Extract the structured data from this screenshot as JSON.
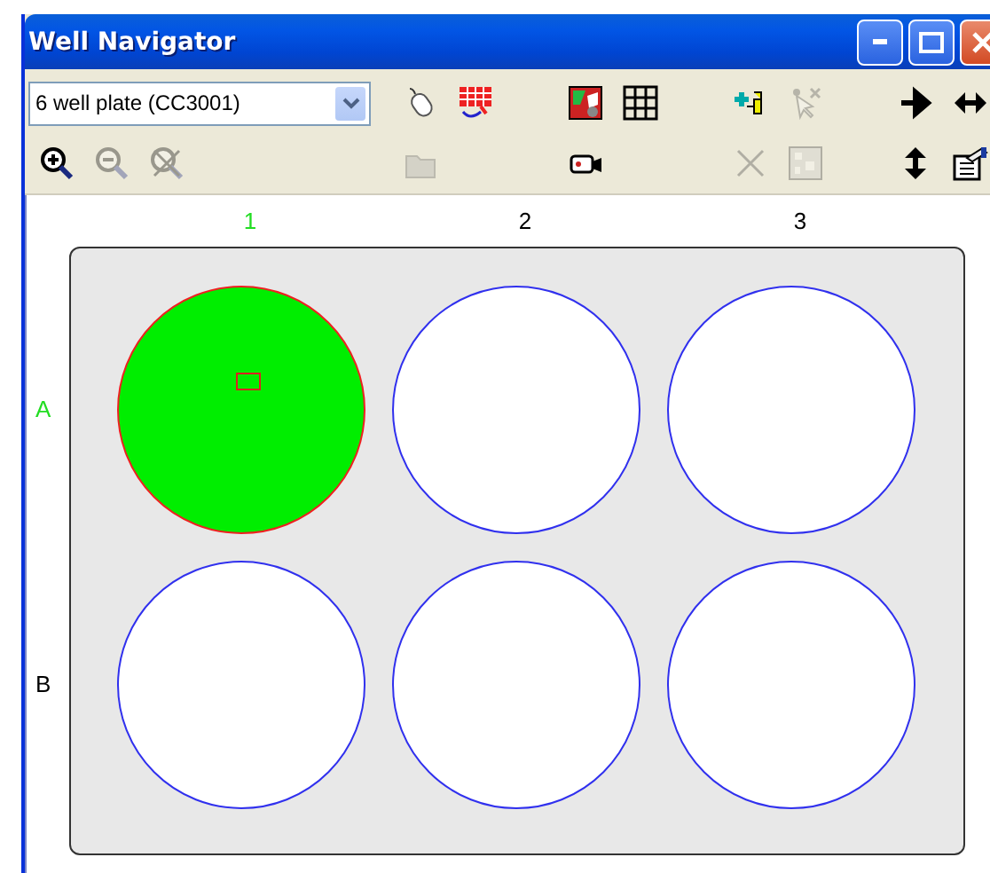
{
  "window": {
    "title": "Well Navigator"
  },
  "plate_select": {
    "value": "6 well plate (CC3001)"
  },
  "zoom_tools": [
    {
      "kind": "zoom-in",
      "disabled": false
    },
    {
      "kind": "zoom-out",
      "disabled": true
    },
    {
      "kind": "zoom-reset",
      "disabled": true
    }
  ],
  "tool_groups": [
    {
      "rows": [
        [
          {
            "kind": "mouse",
            "disabled": false
          },
          {
            "kind": "grid-move",
            "disabled": false
          }
        ],
        [
          {
            "kind": "folder",
            "disabled": true
          }
        ]
      ]
    },
    {
      "rows": [
        [
          {
            "kind": "color-map",
            "disabled": false
          },
          {
            "kind": "grid",
            "disabled": false
          }
        ],
        [
          {
            "kind": "camera",
            "disabled": false
          }
        ]
      ]
    },
    {
      "rows": [
        [
          {
            "kind": "add-wells",
            "disabled": false
          },
          {
            "kind": "cursor",
            "disabled": true
          }
        ],
        [
          {
            "kind": "cross",
            "disabled": true
          },
          {
            "kind": "pattern",
            "disabled": true
          }
        ]
      ]
    },
    {
      "rows": [
        [
          {
            "kind": "arrow-right",
            "disabled": false
          },
          {
            "kind": "arrow-left-right",
            "disabled": false
          }
        ],
        [
          {
            "kind": "arrow-up-down",
            "disabled": false
          },
          {
            "kind": "properties",
            "disabled": false
          }
        ]
      ]
    }
  ],
  "columns": [
    {
      "label": "1",
      "selected": true
    },
    {
      "label": "2",
      "selected": false
    },
    {
      "label": "3",
      "selected": false
    }
  ],
  "rows": [
    {
      "label": "A",
      "selected": true,
      "wells": [
        {
          "selected": true,
          "marker": true
        },
        {
          "selected": false,
          "marker": false
        },
        {
          "selected": false,
          "marker": false
        }
      ]
    },
    {
      "label": "B",
      "selected": false,
      "wells": [
        {
          "selected": false,
          "marker": false
        },
        {
          "selected": false,
          "marker": false
        },
        {
          "selected": false,
          "marker": false
        }
      ]
    }
  ]
}
